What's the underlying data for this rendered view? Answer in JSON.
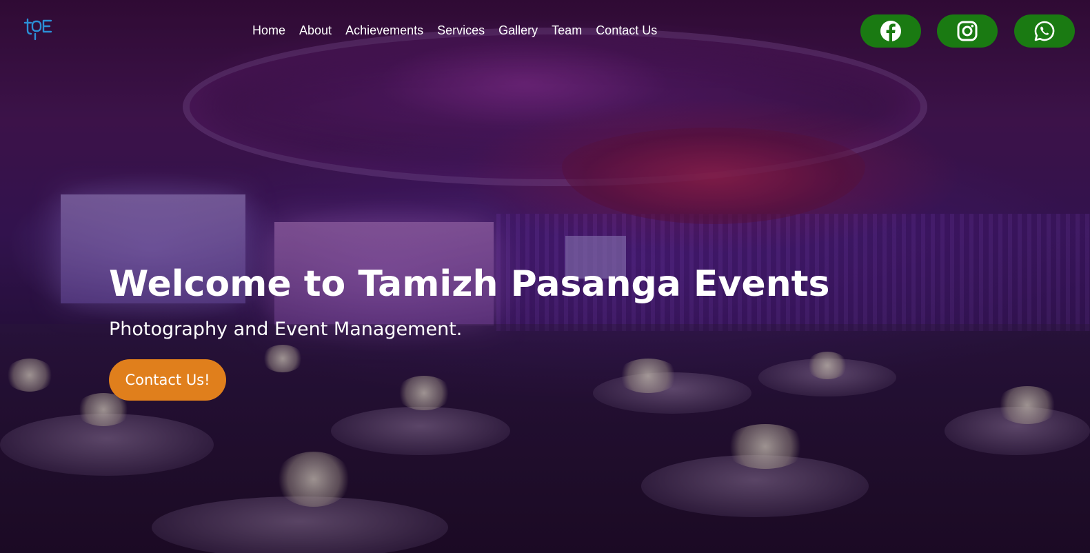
{
  "nav": {
    "logo_text": "tpe",
    "links": [
      {
        "label": "Home"
      },
      {
        "label": "About"
      },
      {
        "label": "Achievements"
      },
      {
        "label": "Services"
      },
      {
        "label": "Gallery"
      },
      {
        "label": "Team"
      },
      {
        "label": "Contact Us"
      }
    ],
    "social": [
      {
        "icon": "facebook-icon"
      },
      {
        "icon": "instagram-icon"
      },
      {
        "icon": "whatsapp-icon"
      }
    ]
  },
  "hero": {
    "title": "Welcome to Tamizh Pasanga Events",
    "subtitle": "Photography and Event Management.",
    "cta_label": "Contact Us!"
  },
  "colors": {
    "social_button": "#1a7a12",
    "cta_button": "#e07f1c",
    "logo": "#2b8fd6",
    "text": "#ffffff"
  }
}
